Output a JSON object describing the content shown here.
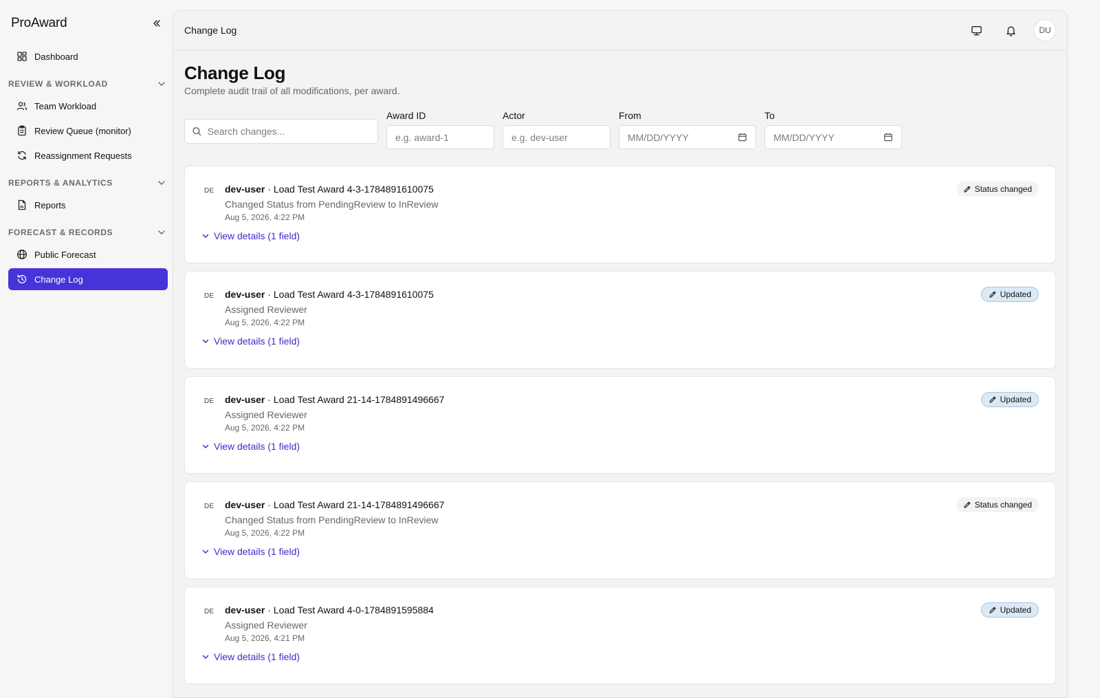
{
  "sidebar": {
    "brand": "ProAward",
    "dashboard": "Dashboard",
    "sections": [
      {
        "title": "REVIEW & WORKLOAD",
        "items": [
          "Team Workload",
          "Review Queue (monitor)",
          "Reassignment Requests"
        ]
      },
      {
        "title": "REPORTS & ANALYTICS",
        "items": [
          "Reports"
        ]
      },
      {
        "title": "FORECAST & RECORDS",
        "items": [
          "Public Forecast",
          "Change Log"
        ]
      }
    ],
    "active": "Change Log"
  },
  "topbar": {
    "title": "Change Log",
    "avatar": "DU"
  },
  "page": {
    "title": "Change Log",
    "subtitle": "Complete audit trail of all modifications, per award."
  },
  "filters": {
    "search_placeholder": "Search changes...",
    "award_label": "Award ID",
    "award_placeholder": "e.g. award-1",
    "actor_label": "Actor",
    "actor_placeholder": "e.g. dev-user",
    "from_label": "From",
    "from_placeholder": "MM/DD/YYYY",
    "to_label": "To",
    "to_placeholder": "MM/DD/YYYY"
  },
  "entries": [
    {
      "initials": "DE",
      "actor": "dev-user",
      "award": "Load Test Award 4-3-1784891610075",
      "desc": "Changed Status from PendingReview to InReview",
      "time": "Aug 5, 2026, 4:22 PM",
      "details": "View details (1 field)",
      "badge": "Status changed",
      "badge_type": "status"
    },
    {
      "initials": "DE",
      "actor": "dev-user",
      "award": "Load Test Award 4-3-1784891610075",
      "desc": "Assigned Reviewer",
      "time": "Aug 5, 2026, 4:22 PM",
      "details": "View details (1 field)",
      "badge": "Updated",
      "badge_type": "updated"
    },
    {
      "initials": "DE",
      "actor": "dev-user",
      "award": "Load Test Award 21-14-1784891496667",
      "desc": "Assigned Reviewer",
      "time": "Aug 5, 2026, 4:22 PM",
      "details": "View details (1 field)",
      "badge": "Updated",
      "badge_type": "updated"
    },
    {
      "initials": "DE",
      "actor": "dev-user",
      "award": "Load Test Award 21-14-1784891496667",
      "desc": "Changed Status from PendingReview to InReview",
      "time": "Aug 5, 2026, 4:22 PM",
      "details": "View details (1 field)",
      "badge": "Status changed",
      "badge_type": "status"
    },
    {
      "initials": "DE",
      "actor": "dev-user",
      "award": "Load Test Award 4-0-1784891595884",
      "desc": "Assigned Reviewer",
      "time": "Aug 5, 2026, 4:21 PM",
      "details": "View details (1 field)",
      "badge": "Updated",
      "badge_type": "updated"
    }
  ]
}
